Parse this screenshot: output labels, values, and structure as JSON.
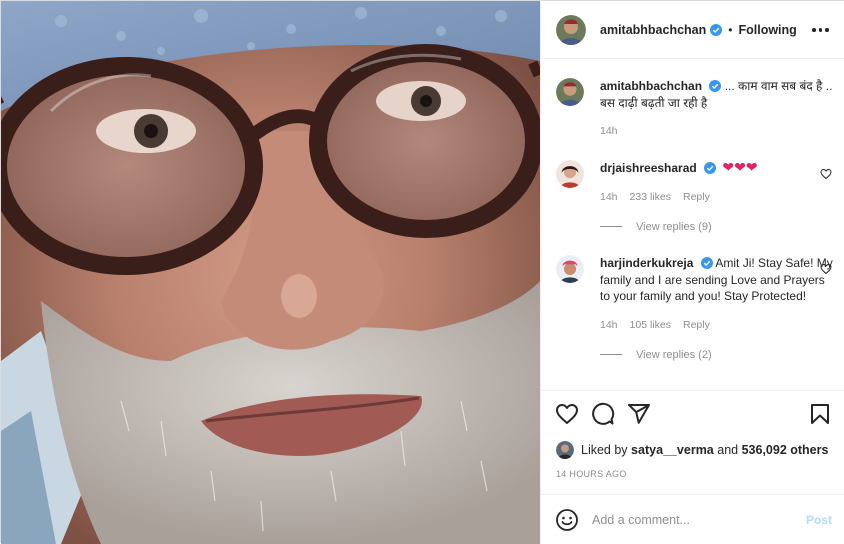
{
  "post": {
    "username": "amitabhbachchan",
    "follow_state": "Following",
    "separator": "•"
  },
  "caption": {
    "username": "amitabhbachchan",
    "text": "... काम वाम सब बंद है .. बस दाढ़ी बढ़ती जा रही है",
    "time": "14h"
  },
  "comments": [
    {
      "username": "drjaishreesharad",
      "text": "❤❤❤",
      "time": "14h",
      "likes": "233 likes",
      "reply_label": "Reply",
      "view_replies": "View replies (9)"
    },
    {
      "username": "harjinderkukreja",
      "text": "Amit Ji! Stay Safe! My family and I are sending Love and Prayers to your family and you! Stay Protected!",
      "time": "14h",
      "likes": "105 likes",
      "reply_label": "Reply",
      "view_replies": "View replies (2)"
    }
  ],
  "likes": {
    "prefix": "Liked by",
    "user": "satya__verma",
    "and": "and",
    "count": "536,092 others"
  },
  "timestamp": "14 HOURS AGO",
  "add_comment": {
    "placeholder": "Add a comment...",
    "post_label": "Post"
  },
  "icons": {
    "verified": "verified-badge-icon",
    "more": "more-options-icon",
    "like": "heart-icon",
    "comment": "comment-icon",
    "share": "share-icon",
    "save": "bookmark-icon",
    "emoji": "emoji-icon"
  },
  "colors": {
    "verified": "#3897f0",
    "heart_emoji": "#e0245e",
    "post_disabled": "#b3dbff",
    "secondary_text": "#8e8e8e"
  }
}
